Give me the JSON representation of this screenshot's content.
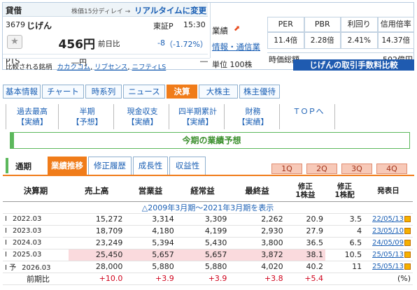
{
  "header": {
    "label": "貸借",
    "delay_note": "株価15分ディレイ →",
    "realtime_link": "リアルタイムに変更",
    "code": "3679",
    "name": "じげん",
    "market": "東証P",
    "time": "15:30",
    "price": "456円",
    "prev_label": "前日比",
    "change": "-8",
    "change_pct": "（-1.72%）",
    "pts_label": "PTS",
    "pts_value": "―円",
    "pts_change": "―",
    "compare_label": "比較される銘柄",
    "compare": [
      "カカクコム",
      "リブセンス",
      "ニフティLS"
    ],
    "gyoseki_label": "業績",
    "info_link": "情報・通信業",
    "unit": "単位 100株",
    "metrics": [
      {
        "name": "PER",
        "value": "11.4倍"
      },
      {
        "name": "PBR",
        "value": "2.28倍"
      },
      {
        "name": "利回り",
        "value": "2.41%"
      },
      {
        "name": "信用倍率",
        "value": "14.37倍"
      }
    ],
    "mcap_label": "時価総額",
    "mcap_value": "502億円",
    "fee_banner": "じげんの取引手数料比較"
  },
  "tabs": [
    "基本情報",
    "チャート",
    "時系列",
    "ニュース",
    "決算",
    "大株主",
    "株主優待"
  ],
  "active_tab": "決算",
  "subnav": [
    {
      "a": "過去最高",
      "b": "【実績】"
    },
    {
      "a": "半期",
      "b": "【予想】"
    },
    {
      "a": "現金収支",
      "b": "【実績】"
    },
    {
      "a": "四半期累計",
      "b": "【実績】"
    },
    {
      "a": "財務",
      "b": "【実績】"
    },
    {
      "a": "ＴＯＰへ",
      "b": ""
    }
  ],
  "section_title": "今期の業績予想",
  "period_label": "通期",
  "sub_tabs": [
    "業績推移",
    "修正履歴",
    "成長性",
    "収益性"
  ],
  "quarters": [
    "1Q",
    "2Q",
    "3Q",
    "4Q"
  ],
  "table": {
    "headers": [
      "決算期",
      "売上高",
      "営業益",
      "経常益",
      "最終益",
      "修正\n1株益",
      "修正\n1株配",
      "発表日"
    ],
    "range_note": "△2009年3月期～2021年3月期を表示",
    "rows": [
      {
        "mark": "I",
        "period": "2022.03",
        "sales": "15,272",
        "op": "3,314",
        "ord": "3,309",
        "net": "2,262",
        "eps": "20.9",
        "div": "3.5",
        "date": "22/05/13"
      },
      {
        "mark": "I",
        "period": "2023.03",
        "sales": "18,709",
        "op": "4,180",
        "ord": "4,199",
        "net": "2,930",
        "eps": "27.9",
        "div": "4",
        "date": "23/05/10"
      },
      {
        "mark": "I",
        "period": "2024.03",
        "sales": "23,249",
        "op": "5,394",
        "ord": "5,430",
        "net": "3,800",
        "eps": "36.5",
        "div": "6.5",
        "date": "24/05/09"
      },
      {
        "mark": "I",
        "period": "2025.03",
        "sales": "25,450",
        "op": "5,657",
        "ord": "5,657",
        "net": "3,872",
        "eps": "38.1",
        "div": "10.5",
        "date": "25/05/13"
      },
      {
        "mark": "I 予",
        "period": "2026.03",
        "sales": "28,000",
        "op": "5,880",
        "ord": "5,880",
        "net": "4,020",
        "eps": "40.2",
        "div": "11",
        "date": "25/05/13"
      }
    ],
    "yoy": {
      "label": "前期比",
      "sales": "+10.0",
      "op": "+3.9",
      "ord": "+3.9",
      "net": "+3.8",
      "eps": "+5.4",
      "div": "",
      "date": "(%)"
    }
  }
}
